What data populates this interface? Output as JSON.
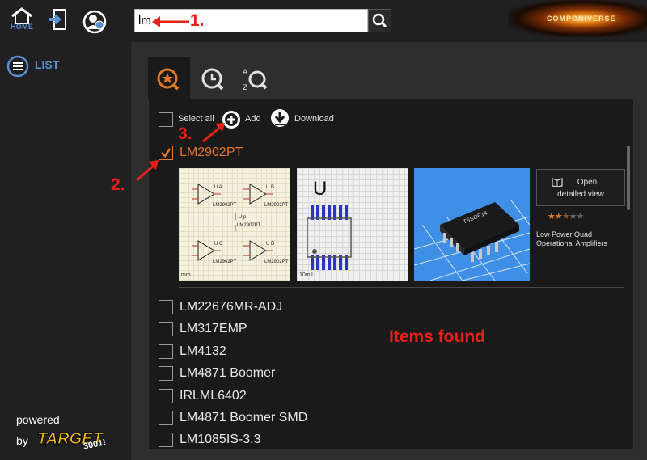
{
  "topbar": {
    "home_label": "HOME",
    "search_value": "lm",
    "logo_text": "COMPONIVERSE"
  },
  "sidebar": {
    "list_label": "LIST",
    "powered_label": "powered",
    "by_label": "by",
    "target_brand": "TARGET",
    "target_version": "3001!"
  },
  "toolbar": {
    "select_all_label": "Select all",
    "add_label": "Add",
    "download_label": "Download"
  },
  "selected_part": {
    "name": "LM2902PT",
    "open_label_line1": "Open",
    "open_label_line2": "detailed view",
    "rating": 2.5,
    "description": "Low Power Quad Operational Amplifiers",
    "symbol_scale": "mm",
    "footprint_scale": "10mil",
    "footprint_letter": "U",
    "package_label": "TSSOP14",
    "symbol_units": [
      {
        "unit": "U A",
        "part": "LM2902PT"
      },
      {
        "unit": "U B",
        "part": "LM2902PT"
      },
      {
        "unit": "U C",
        "part": "LM2902PT"
      },
      {
        "unit": "U D",
        "part": "LM2902PT"
      }
    ],
    "power_unit": "U p",
    "power_part": "LM2902PT"
  },
  "results": [
    "LM22676MR-ADJ",
    "LM317EMP",
    "LM4132",
    "LM4871 Boomer",
    "IRLML6402",
    "LM4871 Boomer SMD",
    "LM1085IS-3.3"
  ],
  "annotations": {
    "step1": "1.",
    "step2": "2.",
    "step3": "3.",
    "items_found": "Items found"
  },
  "colors": {
    "accent_orange": "#e0742a",
    "link_blue": "#5a8fd0",
    "annotation_red": "#e8201a"
  }
}
